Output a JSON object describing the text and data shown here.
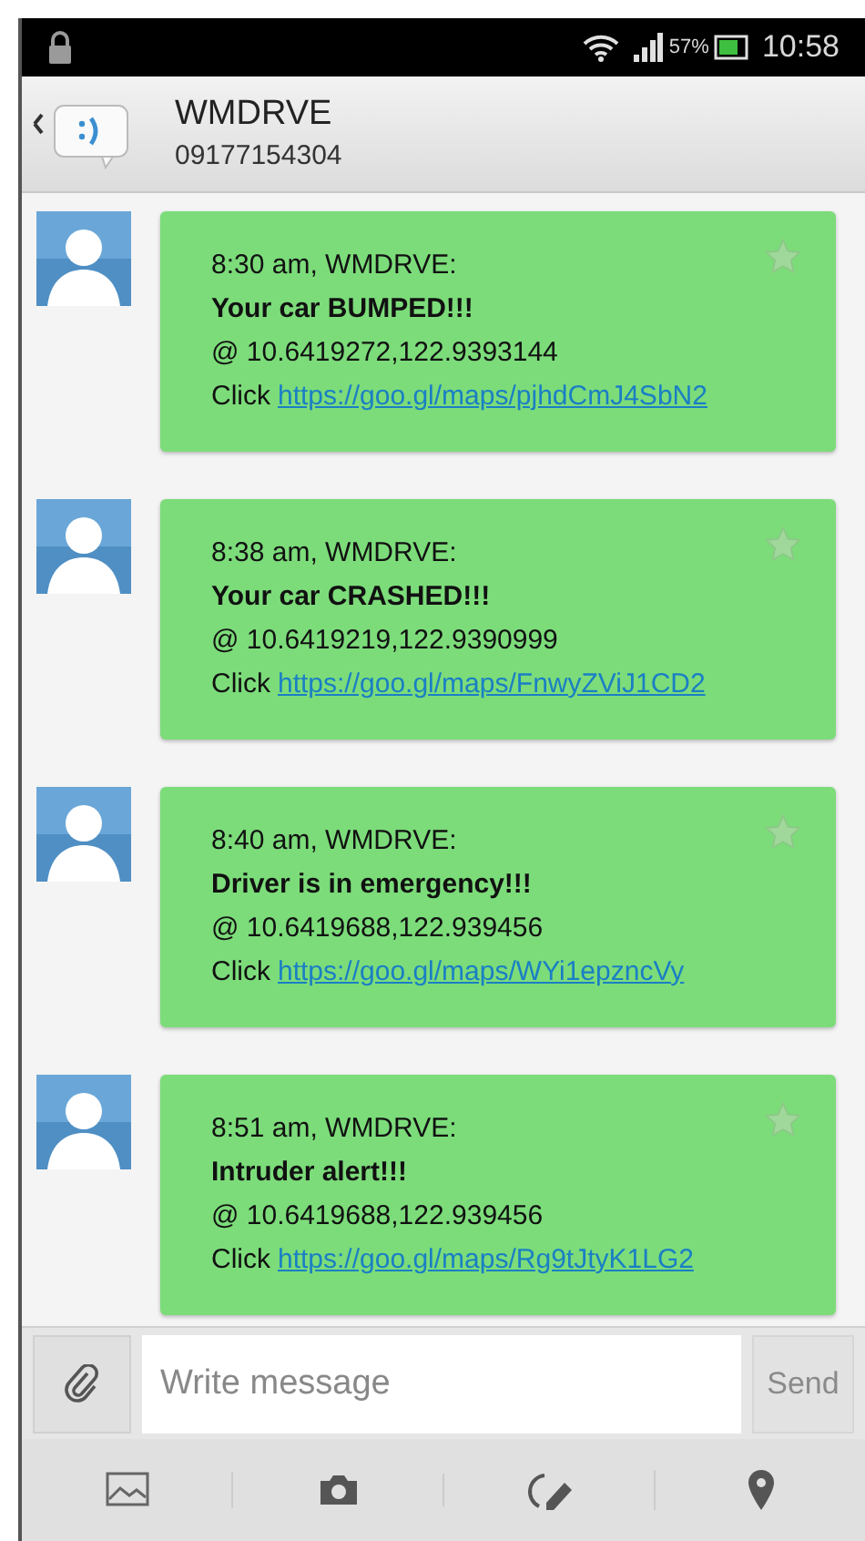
{
  "status_bar": {
    "battery": "57%",
    "time": "10:58"
  },
  "header": {
    "name": "WMDRVE",
    "number": "09177154304"
  },
  "messages": [
    {
      "meta": "8:30 am, WMDRVE:",
      "alert": "Your car BUMPED!!!",
      "coords": "@ 10.6419272,122.9393144",
      "click": "Click",
      "link": "https://goo.gl/maps/pjhdCmJ4SbN2",
      "starred": false
    },
    {
      "meta": "8:38 am, WMDRVE:",
      "alert": "Your car CRASHED!!!",
      "coords": "@ 10.6419219,122.9390999",
      "click": "Click",
      "link": "https://goo.gl/maps/FnwyZViJ1CD2",
      "starred": false
    },
    {
      "meta": "8:40 am, WMDRVE:",
      "alert": "Driver is in emergency!!!",
      "coords": "@ 10.6419688,122.939456",
      "click": "Click",
      "link": "https://goo.gl/maps/WYi1epzncVy",
      "starred": false
    },
    {
      "meta": "8:51 am, WMDRVE:",
      "alert": "Intruder alert!!!",
      "coords": "@ 10.6419688,122.939456",
      "click": "Click",
      "link": "https://goo.gl/maps/Rg9tJtyK1LG2",
      "starred": false
    }
  ],
  "composer": {
    "placeholder": "Write message",
    "send": {
      "label": "Send",
      "disabled": true
    }
  }
}
